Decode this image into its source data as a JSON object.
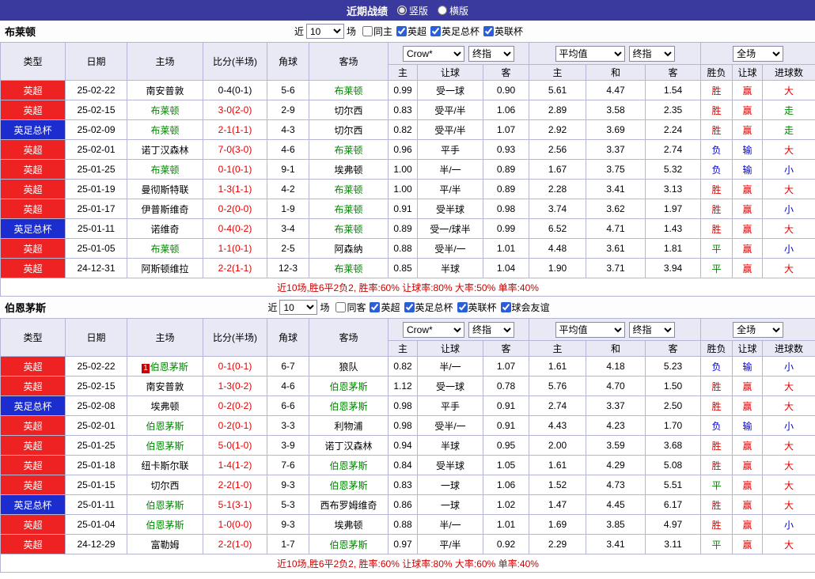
{
  "topbar": {
    "title": "近期战绩",
    "vertical_label": "竖版",
    "horizontal_label": "横版"
  },
  "sections": [
    {
      "team": "布莱顿",
      "filter": {
        "near": "近",
        "count": "10",
        "games": "场",
        "same_venue": "同主",
        "leagues": [
          "英超",
          "英足总杯",
          "英联杯"
        ]
      },
      "header": {
        "type": "类型",
        "date": "日期",
        "home": "主场",
        "score": "比分(半场)",
        "corner": "角球",
        "away": "客场",
        "odds_source": "Crow*",
        "odds_mode": "终指",
        "avg_source": "平均值",
        "avg_mode": "终指",
        "scope": "全场",
        "sub": [
          "主",
          "让球",
          "客",
          "主",
          "和",
          "客",
          "胜负",
          "让球",
          "进球数"
        ]
      },
      "rows": [
        {
          "league": "英超",
          "lc": "red",
          "date": "25-02-22",
          "home": "南安普敦",
          "hg": false,
          "score": "0-4(0-1)",
          "sc": "black",
          "corner": "5-6",
          "away": "布莱顿",
          "ag": true,
          "o1": "0.99",
          "hcp": "受一球",
          "o2": "0.90",
          "a1": "5.61",
          "a2": "4.47",
          "a3": "1.54",
          "res": [
            [
              "胜",
              "red"
            ],
            [
              "赢",
              "red"
            ],
            [
              "大",
              "red"
            ]
          ]
        },
        {
          "league": "英超",
          "lc": "red",
          "date": "25-02-15",
          "home": "布莱顿",
          "hg": true,
          "score": "3-0(2-0)",
          "sc": "red",
          "corner": "2-9",
          "away": "切尔西",
          "ag": false,
          "o1": "0.83",
          "hcp": "受平/半",
          "o2": "1.06",
          "a1": "2.89",
          "a2": "3.58",
          "a3": "2.35",
          "res": [
            [
              "胜",
              "red"
            ],
            [
              "赢",
              "red"
            ],
            [
              "走",
              "green"
            ]
          ]
        },
        {
          "league": "英足总杯",
          "lc": "blue",
          "date": "25-02-09",
          "home": "布莱顿",
          "hg": true,
          "score": "2-1(1-1)",
          "sc": "red",
          "corner": "4-3",
          "away": "切尔西",
          "ag": false,
          "o1": "0.82",
          "hcp": "受平/半",
          "o2": "1.07",
          "a1": "2.92",
          "a2": "3.69",
          "a3": "2.24",
          "res": [
            [
              "胜",
              "red"
            ],
            [
              "赢",
              "red"
            ],
            [
              "走",
              "green"
            ]
          ]
        },
        {
          "league": "英超",
          "lc": "red",
          "date": "25-02-01",
          "home": "诺丁汉森林",
          "hg": false,
          "score": "7-0(3-0)",
          "sc": "red",
          "corner": "4-6",
          "away": "布莱顿",
          "ag": true,
          "o1": "0.96",
          "hcp": "平手",
          "o2": "0.93",
          "a1": "2.56",
          "a2": "3.37",
          "a3": "2.74",
          "res": [
            [
              "负",
              "blue"
            ],
            [
              "输",
              "blue"
            ],
            [
              "大",
              "red"
            ]
          ]
        },
        {
          "league": "英超",
          "lc": "red",
          "date": "25-01-25",
          "home": "布莱顿",
          "hg": true,
          "score": "0-1(0-1)",
          "sc": "red",
          "corner": "9-1",
          "away": "埃弗顿",
          "ag": false,
          "o1": "1.00",
          "hcp": "半/一",
          "o2": "0.89",
          "a1": "1.67",
          "a2": "3.75",
          "a3": "5.32",
          "res": [
            [
              "负",
              "blue"
            ],
            [
              "输",
              "blue"
            ],
            [
              "小",
              "blue"
            ]
          ]
        },
        {
          "league": "英超",
          "lc": "red",
          "date": "25-01-19",
          "home": "曼彻斯特联",
          "hg": false,
          "score": "1-3(1-1)",
          "sc": "red",
          "corner": "4-2",
          "away": "布莱顿",
          "ag": true,
          "o1": "1.00",
          "hcp": "平/半",
          "o2": "0.89",
          "a1": "2.28",
          "a2": "3.41",
          "a3": "3.13",
          "res": [
            [
              "胜",
              "red"
            ],
            [
              "赢",
              "red"
            ],
            [
              "大",
              "red"
            ]
          ]
        },
        {
          "league": "英超",
          "lc": "red",
          "date": "25-01-17",
          "home": "伊普斯维奇",
          "hg": false,
          "score": "0-2(0-0)",
          "sc": "red",
          "corner": "1-9",
          "away": "布莱顿",
          "ag": true,
          "o1": "0.91",
          "hcp": "受半球",
          "o2": "0.98",
          "a1": "3.74",
          "a2": "3.62",
          "a3": "1.97",
          "res": [
            [
              "胜",
              "red"
            ],
            [
              "赢",
              "red"
            ],
            [
              "小",
              "blue"
            ]
          ]
        },
        {
          "league": "英足总杯",
          "lc": "blue",
          "date": "25-01-11",
          "home": "诺维奇",
          "hg": false,
          "score": "0-4(0-2)",
          "sc": "red",
          "corner": "3-4",
          "away": "布莱顿",
          "ag": true,
          "o1": "0.89",
          "hcp": "受一/球半",
          "o2": "0.99",
          "a1": "6.52",
          "a2": "4.71",
          "a3": "1.43",
          "res": [
            [
              "胜",
              "red"
            ],
            [
              "赢",
              "red"
            ],
            [
              "大",
              "red"
            ]
          ]
        },
        {
          "league": "英超",
          "lc": "red",
          "date": "25-01-05",
          "home": "布莱顿",
          "hg": true,
          "score": "1-1(0-1)",
          "sc": "red",
          "corner": "2-5",
          "away": "阿森纳",
          "ag": false,
          "o1": "0.88",
          "hcp": "受半/一",
          "o2": "1.01",
          "a1": "4.48",
          "a2": "3.61",
          "a3": "1.81",
          "res": [
            [
              "平",
              "green"
            ],
            [
              "赢",
              "red"
            ],
            [
              "小",
              "blue"
            ]
          ]
        },
        {
          "league": "英超",
          "lc": "red",
          "date": "24-12-31",
          "home": "阿斯顿维拉",
          "hg": false,
          "score": "2-2(1-1)",
          "sc": "red",
          "corner": "12-3",
          "away": "布莱顿",
          "ag": true,
          "o1": "0.85",
          "hcp": "半球",
          "o2": "1.04",
          "a1": "1.90",
          "a2": "3.71",
          "a3": "3.94",
          "res": [
            [
              "平",
              "green"
            ],
            [
              "赢",
              "red"
            ],
            [
              "大",
              "red"
            ]
          ]
        }
      ],
      "summary": "近10场,胜6平2负2, 胜率:60% 让球率:80% 大率:50% 单率:40%"
    },
    {
      "team": "伯恩茅斯",
      "filter": {
        "near": "近",
        "count": "10",
        "games": "场",
        "same_venue": "同客",
        "leagues": [
          "英超",
          "英足总杯",
          "英联杯",
          "球会友谊"
        ]
      },
      "header": {
        "type": "类型",
        "date": "日期",
        "home": "主场",
        "score": "比分(半场)",
        "corner": "角球",
        "away": "客场",
        "odds_source": "Crow*",
        "odds_mode": "终指",
        "avg_source": "平均值",
        "avg_mode": "终指",
        "scope": "全场",
        "sub": [
          "主",
          "让球",
          "客",
          "主",
          "和",
          "客",
          "胜负",
          "让球",
          "进球数"
        ]
      },
      "rows": [
        {
          "league": "英超",
          "lc": "red",
          "date": "25-02-22",
          "home": "伯恩茅斯",
          "hg": true,
          "hbadge": "1",
          "score": "0-1(0-1)",
          "sc": "red",
          "corner": "6-7",
          "away": "狼队",
          "ag": false,
          "o1": "0.82",
          "hcp": "半/一",
          "o2": "1.07",
          "a1": "1.61",
          "a2": "4.18",
          "a3": "5.23",
          "res": [
            [
              "负",
              "blue"
            ],
            [
              "输",
              "blue"
            ],
            [
              "小",
              "blue"
            ]
          ]
        },
        {
          "league": "英超",
          "lc": "red",
          "date": "25-02-15",
          "home": "南安普敦",
          "hg": false,
          "score": "1-3(0-2)",
          "sc": "red",
          "corner": "4-6",
          "away": "伯恩茅斯",
          "ag": true,
          "o1": "1.12",
          "hcp": "受一球",
          "o2": "0.78",
          "a1": "5.76",
          "a2": "4.70",
          "a3": "1.50",
          "res": [
            [
              "胜",
              "red"
            ],
            [
              "赢",
              "red"
            ],
            [
              "大",
              "red"
            ]
          ]
        },
        {
          "league": "英足总杯",
          "lc": "blue",
          "date": "25-02-08",
          "home": "埃弗顿",
          "hg": false,
          "score": "0-2(0-2)",
          "sc": "red",
          "corner": "6-6",
          "away": "伯恩茅斯",
          "ag": true,
          "o1": "0.98",
          "hcp": "平手",
          "o2": "0.91",
          "a1": "2.74",
          "a2": "3.37",
          "a3": "2.50",
          "res": [
            [
              "胜",
              "red"
            ],
            [
              "赢",
              "red"
            ],
            [
              "大",
              "red"
            ]
          ]
        },
        {
          "league": "英超",
          "lc": "red",
          "date": "25-02-01",
          "home": "伯恩茅斯",
          "hg": true,
          "score": "0-2(0-1)",
          "sc": "red",
          "corner": "3-3",
          "away": "利物浦",
          "ag": false,
          "o1": "0.98",
          "hcp": "受半/一",
          "o2": "0.91",
          "a1": "4.43",
          "a2": "4.23",
          "a3": "1.70",
          "res": [
            [
              "负",
              "blue"
            ],
            [
              "输",
              "blue"
            ],
            [
              "小",
              "blue"
            ]
          ]
        },
        {
          "league": "英超",
          "lc": "red",
          "date": "25-01-25",
          "home": "伯恩茅斯",
          "hg": true,
          "score": "5-0(1-0)",
          "sc": "red",
          "corner": "3-9",
          "away": "诺丁汉森林",
          "ag": false,
          "o1": "0.94",
          "hcp": "半球",
          "o2": "0.95",
          "a1": "2.00",
          "a2": "3.59",
          "a3": "3.68",
          "res": [
            [
              "胜",
              "red"
            ],
            [
              "赢",
              "red"
            ],
            [
              "大",
              "red"
            ]
          ]
        },
        {
          "league": "英超",
          "lc": "red",
          "date": "25-01-18",
          "home": "纽卡斯尔联",
          "hg": false,
          "score": "1-4(1-2)",
          "sc": "red",
          "corner": "7-6",
          "away": "伯恩茅斯",
          "ag": true,
          "o1": "0.84",
          "hcp": "受半球",
          "o2": "1.05",
          "a1": "1.61",
          "a2": "4.29",
          "a3": "5.08",
          "res": [
            [
              "胜",
              "red"
            ],
            [
              "赢",
              "red"
            ],
            [
              "大",
              "red"
            ]
          ]
        },
        {
          "league": "英超",
          "lc": "red",
          "date": "25-01-15",
          "home": "切尔西",
          "hg": false,
          "score": "2-2(1-0)",
          "sc": "red",
          "corner": "9-3",
          "away": "伯恩茅斯",
          "ag": true,
          "o1": "0.83",
          "hcp": "一球",
          "o2": "1.06",
          "a1": "1.52",
          "a2": "4.73",
          "a3": "5.51",
          "res": [
            [
              "平",
              "green"
            ],
            [
              "赢",
              "red"
            ],
            [
              "大",
              "red"
            ]
          ]
        },
        {
          "league": "英足总杯",
          "lc": "blue",
          "date": "25-01-11",
          "home": "伯恩茅斯",
          "hg": true,
          "score": "5-1(3-1)",
          "sc": "red",
          "corner": "5-3",
          "away": "西布罗姆维奇",
          "ag": false,
          "o1": "0.86",
          "hcp": "一球",
          "o2": "1.02",
          "a1": "1.47",
          "a2": "4.45",
          "a3": "6.17",
          "res": [
            [
              "胜",
              "red"
            ],
            [
              "赢",
              "red"
            ],
            [
              "大",
              "red"
            ]
          ]
        },
        {
          "league": "英超",
          "lc": "red",
          "date": "25-01-04",
          "home": "伯恩茅斯",
          "hg": true,
          "score": "1-0(0-0)",
          "sc": "red",
          "corner": "9-3",
          "away": "埃弗顿",
          "ag": false,
          "o1": "0.88",
          "hcp": "半/一",
          "o2": "1.01",
          "a1": "1.69",
          "a2": "3.85",
          "a3": "4.97",
          "res": [
            [
              "胜",
              "red"
            ],
            [
              "赢",
              "red"
            ],
            [
              "小",
              "blue"
            ]
          ]
        },
        {
          "league": "英超",
          "lc": "red",
          "date": "24-12-29",
          "home": "富勒姆",
          "hg": false,
          "score": "2-2(1-0)",
          "sc": "red",
          "corner": "1-7",
          "away": "伯恩茅斯",
          "ag": true,
          "o1": "0.97",
          "hcp": "平/半",
          "o2": "0.92",
          "a1": "2.29",
          "a2": "3.41",
          "a3": "3.11",
          "res": [
            [
              "平",
              "green"
            ],
            [
              "赢",
              "red"
            ],
            [
              "大",
              "red"
            ]
          ]
        }
      ],
      "summary": "近10场,胜6平2负2, 胜率:60% 让球率:80% 大率:60% 单率:40%"
    }
  ]
}
